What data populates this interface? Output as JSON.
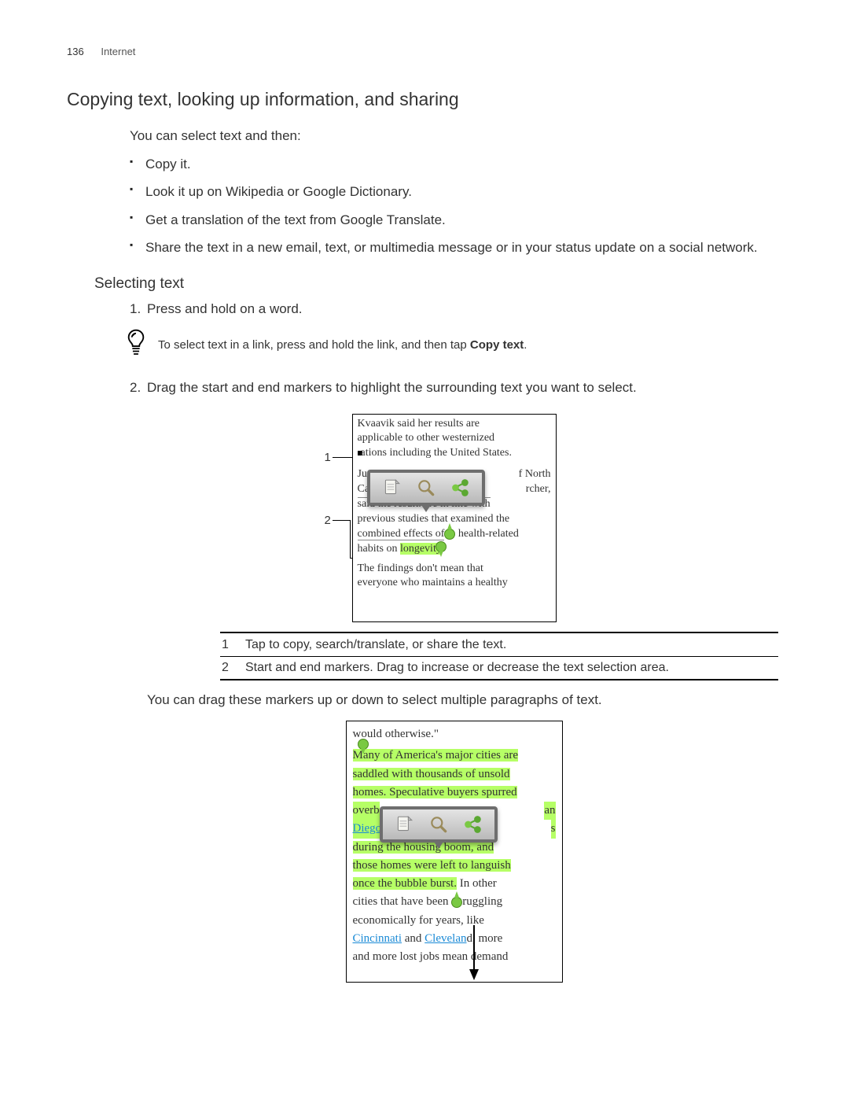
{
  "header": {
    "page_number": "136",
    "section": "Internet"
  },
  "title": "Copying text, looking up information, and sharing",
  "intro": "You can select text and then:",
  "bullets": [
    "Copy it.",
    "Look it up on Wikipedia or Google Dictionary.",
    "Get a translation of the text from Google Translate.",
    "Share the text in a new email, text, or multimedia message or in your status update on a social network."
  ],
  "subsection": "Selecting text",
  "steps": {
    "s1": "Press and hold on a word.",
    "tip_prefix": "To select text in a link, press and hold the link, and then tap ",
    "tip_bold": "Copy text",
    "tip_suffix": ".",
    "s2": "Drag the start and end markers to highlight the surrounding text you want to select."
  },
  "fig1_text": {
    "l1": "Kvaavik said her results are",
    "l2": "applicable to other westernized",
    "l3a": "ations including the United States.",
    "mid_left": "Ju",
    "mid_right": "f North",
    "mid_left2": "Ca",
    "mid_right2": "rcher,",
    "l4": "said the result. are in line with",
    "l5": "previous studies that examined the",
    "l6a": "combined effects of",
    "l6b": " health-related",
    "l7a": "habits on ",
    "l7b": "longevity",
    "l7c": ".",
    "l8": "The findings don't mean that",
    "l9": "everyone who maintains a healthy"
  },
  "callouts": {
    "c1": "1",
    "c2": "2"
  },
  "legend": {
    "r1": "Tap to copy, search/translate, or share the text.",
    "r2": "Start and end markers. Drag to increase or decrease the text selection area."
  },
  "after_legend": "You can drag these markers up or down to select multiple paragraphs of text.",
  "fig2_text": {
    "l0": "would otherwise.\"",
    "l1": "Many of America's major cities are",
    "l2": "saddled with thousands of unsold",
    "l3": "homes. Speculative buyers spurred",
    "l4a": "overb",
    "l4b": "an",
    "l5a": "Diego",
    "l5b": "s",
    "l6": "during the housing boom, and",
    "l7": "those homes were left to languish",
    "l8": "once the bubble burst.",
    "l8b": " In other",
    "l9a": "cities that have been ",
    "l9b": "ruggling",
    "l10": "economically for years, like",
    "l11a": "Cincinnati",
    "l11b": " and ",
    "l11c": "Clevelan",
    "l11d": "d",
    "l11e": ", more",
    "l12": "and more lost jobs mean demand"
  }
}
